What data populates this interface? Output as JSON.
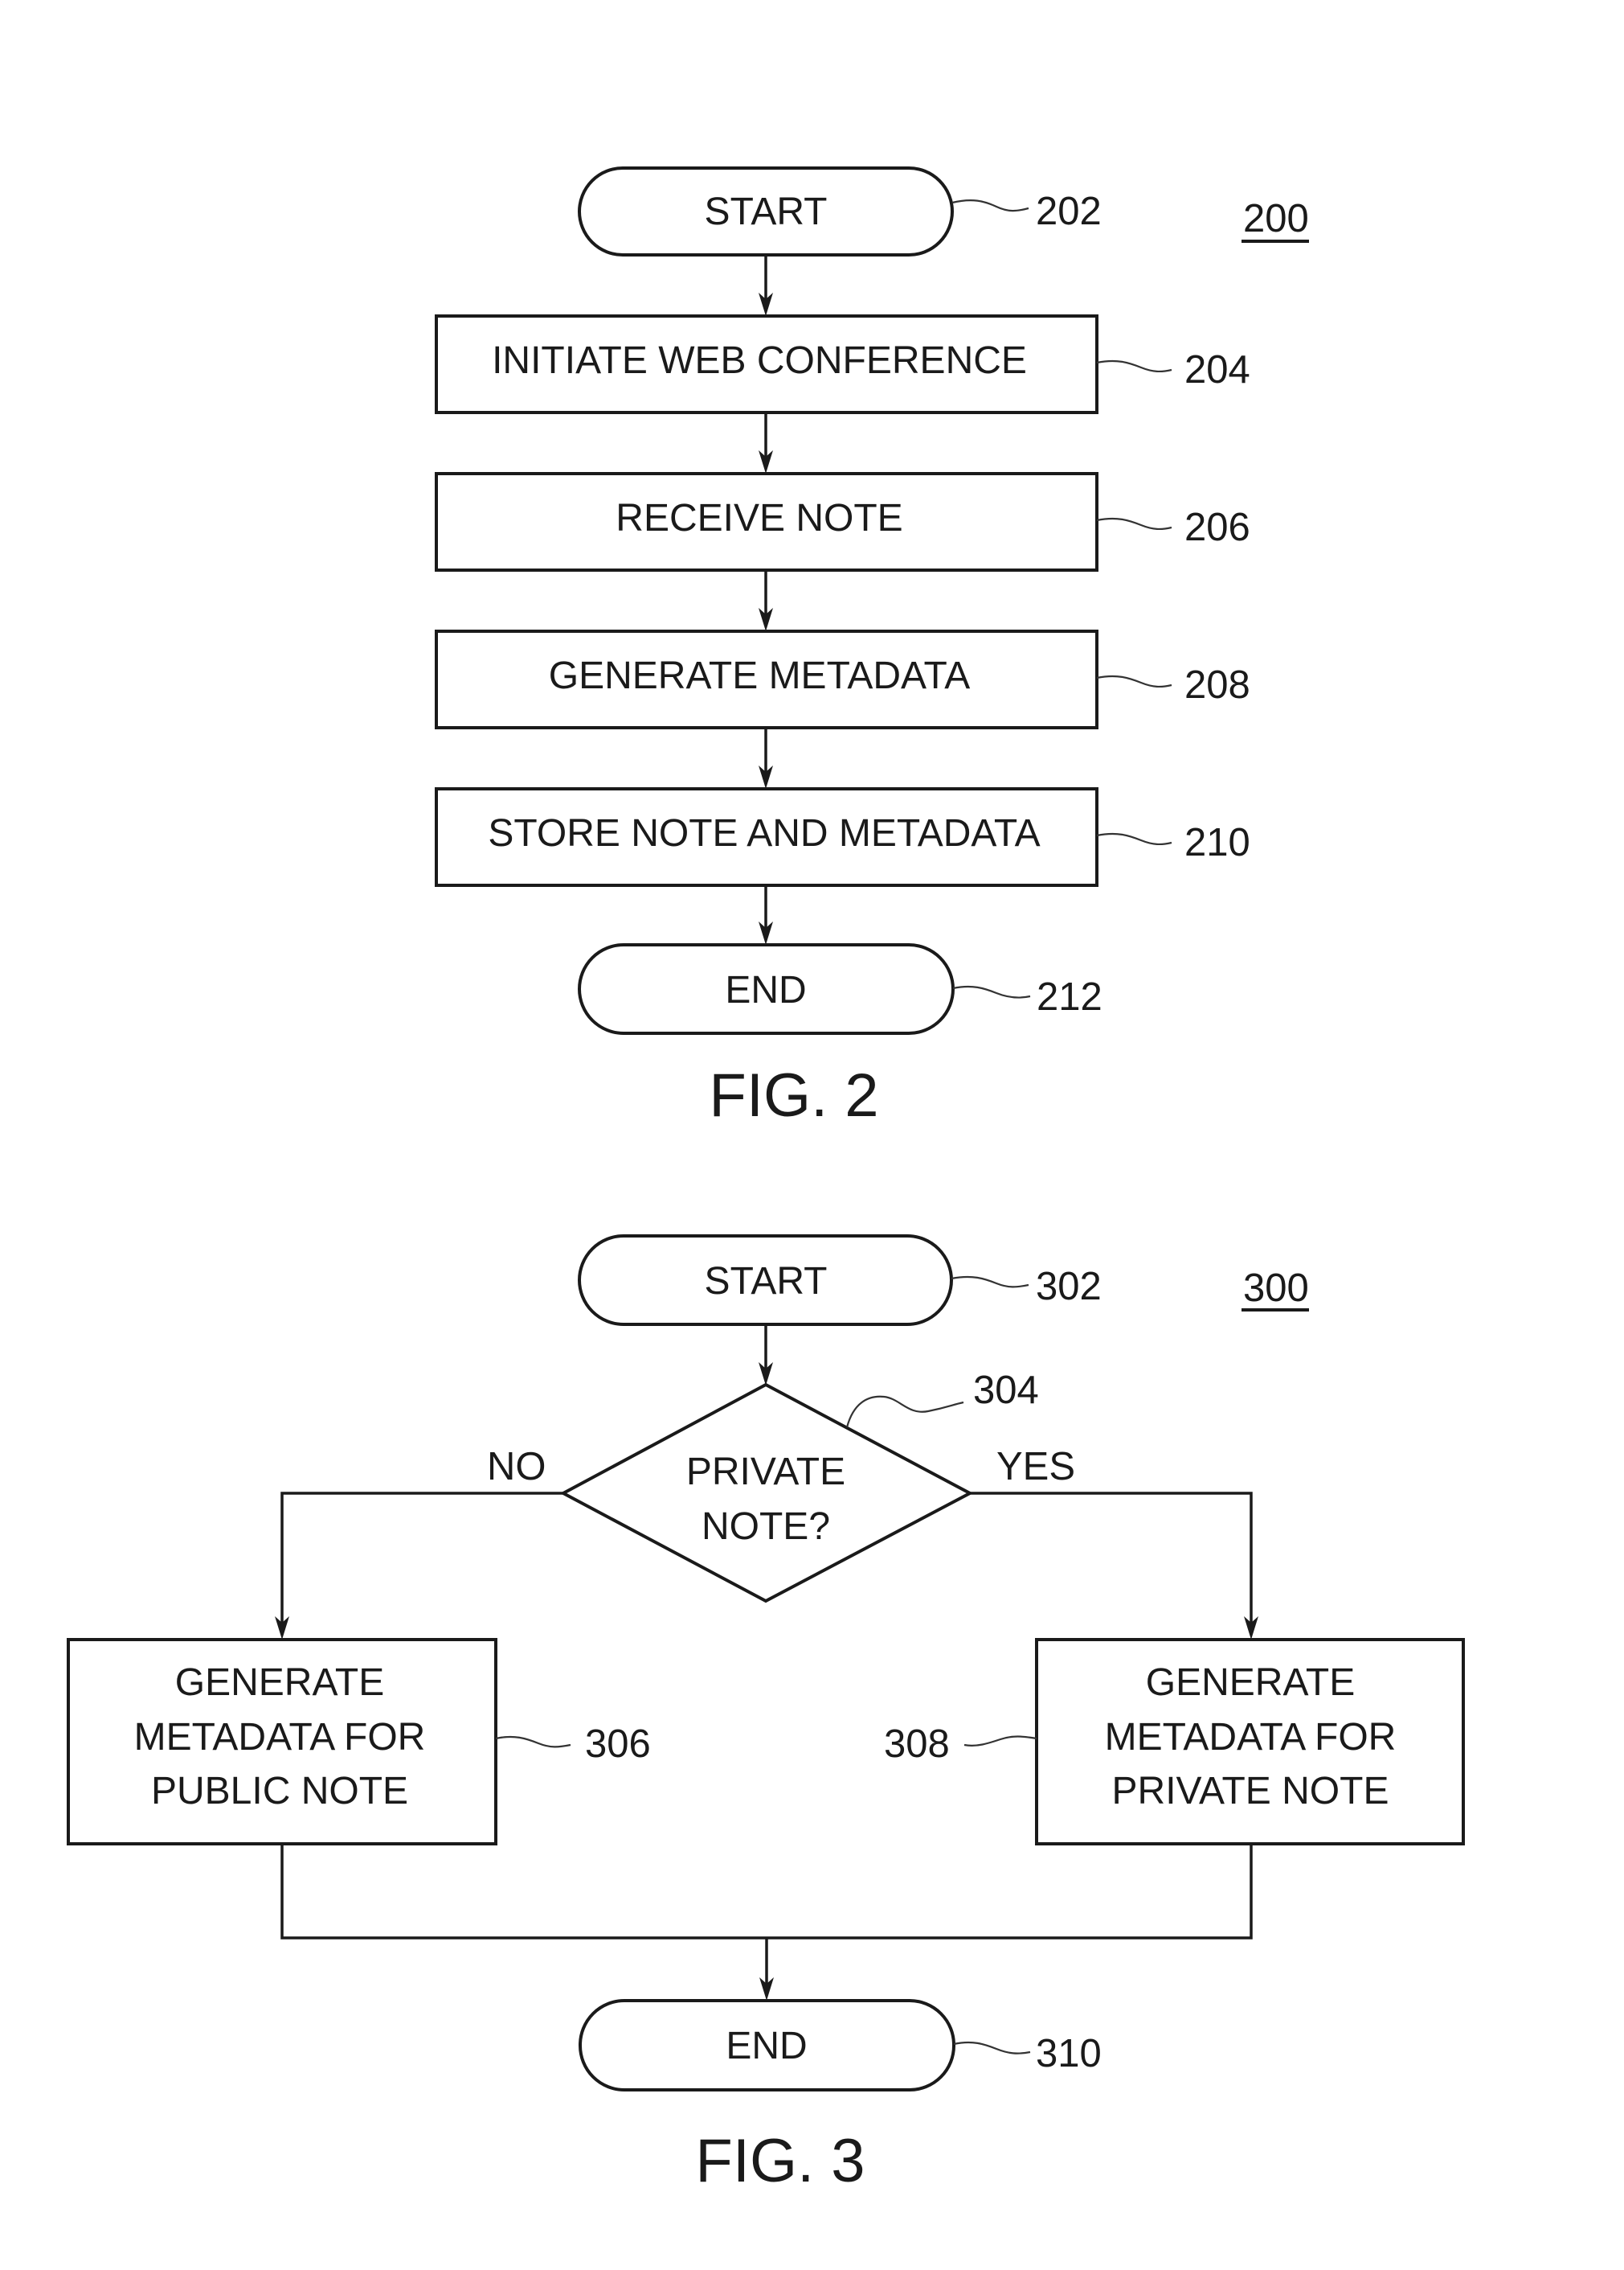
{
  "figure_2": {
    "caption": "FIG. 2",
    "ref_number": "200",
    "nodes": [
      {
        "id": "202",
        "type": "terminal",
        "label": "START",
        "ref": "202"
      },
      {
        "id": "204",
        "type": "process",
        "label": "INITIATE WEB CONFERENCE",
        "ref": "204"
      },
      {
        "id": "206",
        "type": "process",
        "label": "RECEIVE NOTE",
        "ref": "206"
      },
      {
        "id": "208",
        "type": "process",
        "label": "GENERATE METADATA",
        "ref": "208"
      },
      {
        "id": "210",
        "type": "process",
        "label": "STORE NOTE AND METADATA",
        "ref": "210"
      },
      {
        "id": "212",
        "type": "terminal",
        "label": "END",
        "ref": "212"
      }
    ],
    "edges": [
      {
        "from": "202",
        "to": "204"
      },
      {
        "from": "204",
        "to": "206"
      },
      {
        "from": "206",
        "to": "208"
      },
      {
        "from": "208",
        "to": "210"
      },
      {
        "from": "210",
        "to": "212"
      }
    ]
  },
  "figure_3": {
    "caption": "FIG. 3",
    "ref_number": "300",
    "nodes": [
      {
        "id": "302",
        "type": "terminal",
        "label": "START",
        "ref": "302"
      },
      {
        "id": "304",
        "type": "decision",
        "label_lines": [
          "PRIVATE",
          "NOTE?"
        ],
        "ref": "304"
      },
      {
        "id": "306",
        "type": "process",
        "label_lines": [
          "GENERATE",
          "METADATA FOR",
          "PUBLIC NOTE"
        ],
        "ref": "306"
      },
      {
        "id": "308",
        "type": "process",
        "label_lines": [
          "GENERATE",
          "METADATA FOR",
          "PRIVATE NOTE"
        ],
        "ref": "308"
      },
      {
        "id": "310",
        "type": "terminal",
        "label": "END",
        "ref": "310"
      }
    ],
    "branch_labels": {
      "no": "NO",
      "yes": "YES"
    },
    "edges": [
      {
        "from": "302",
        "to": "304"
      },
      {
        "from": "304",
        "to": "306",
        "label": "NO"
      },
      {
        "from": "304",
        "to": "308",
        "label": "YES"
      },
      {
        "from": "306",
        "to": "310"
      },
      {
        "from": "308",
        "to": "310"
      }
    ]
  }
}
